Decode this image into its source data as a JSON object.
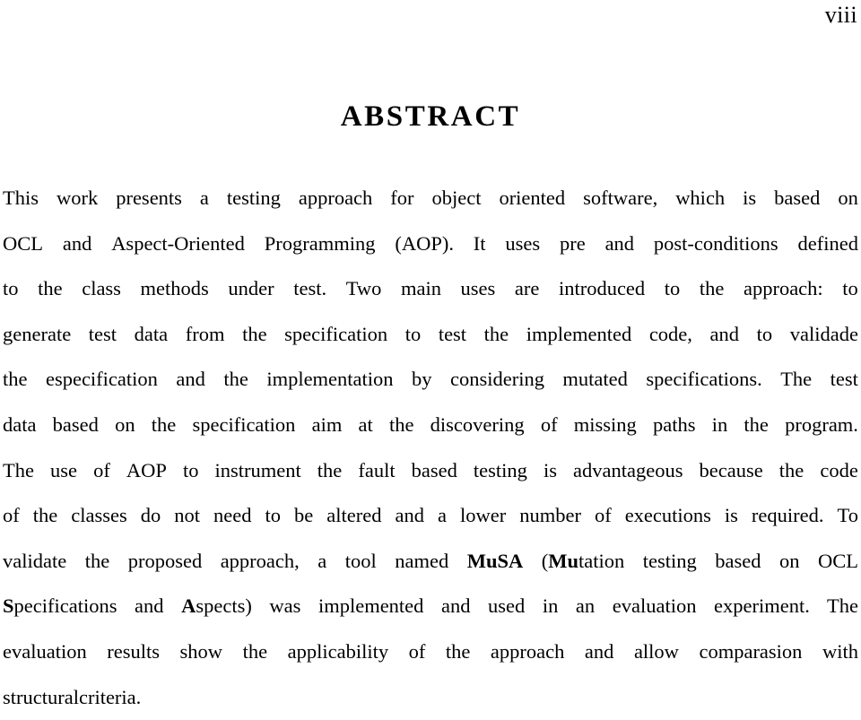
{
  "page": {
    "folio": "viii",
    "heading": "ABSTRACT"
  },
  "abstract": {
    "full_text": "This work presents a testing approach for object oriented software, which is based on OCL and Aspect-Oriented Programming (AOP). It uses pre and post-conditions defined to the class methods under test. Two main uses are introduced to the approach: to generate test data from the specification to test the implemented code, and to validade the especification and the implementation by considering mutated specifications. The test data based on the specification aim at the discovering of missing paths in the program. The use of AOP to instrument the fault based testing is advantageous because the code of the classes do not need to be altered and a lower number of executions is required. To validate the proposed approach, a tool named MuSA (Mutation testing based on OCL Specifications and Aspects) was implemented and used in an evaluation experiment. The evaluation results show the applicability of the approach and allow comparasion with structural criteria.",
    "lines": [
      {
        "id": "line-1",
        "words": [
          "This",
          "work",
          "presents",
          "a",
          "testing",
          "approach",
          "for",
          "object",
          "oriented",
          "software,",
          "which",
          "is",
          "based",
          "on"
        ]
      },
      {
        "id": "line-2",
        "words": [
          "OCL",
          "and",
          "Aspect-Oriented",
          "Programming",
          "(AOP).",
          "It",
          "uses",
          "pre",
          "and",
          "post-conditions",
          "defined"
        ]
      },
      {
        "id": "line-3",
        "words": [
          "to",
          "the",
          "class",
          "methods",
          "under",
          "test.",
          "Two",
          "main",
          "uses",
          "are",
          "introduced",
          "to",
          "the",
          "approach:",
          "to"
        ]
      },
      {
        "id": "line-4",
        "words": [
          "generate",
          "test",
          "data",
          "from",
          "the",
          "specification",
          "to",
          "test",
          "the",
          "implemented",
          "code,",
          "and",
          "to",
          "validade"
        ]
      },
      {
        "id": "line-5",
        "words": [
          "the",
          "especification",
          "and",
          "the",
          "implementation",
          "by",
          "considering",
          "mutated",
          "specifications.",
          "The",
          "test"
        ]
      },
      {
        "id": "line-6",
        "words": [
          "data",
          "based",
          "on",
          "the",
          "specification",
          "aim",
          "at",
          "the",
          "discovering",
          "of",
          "missing",
          "paths",
          "in",
          "the",
          "program."
        ]
      },
      {
        "id": "line-7",
        "words": [
          "The",
          "use",
          "of",
          "AOP",
          "to",
          "instrument",
          "the",
          "fault",
          "based",
          "testing",
          "is",
          "advantageous",
          "because",
          "the",
          "code"
        ]
      },
      {
        "id": "line-8",
        "words": [
          "of",
          "the",
          "classes",
          "do",
          "not",
          "need",
          "to",
          "be",
          "altered",
          "and",
          "a",
          "lower",
          "number",
          "of",
          "executions",
          "is",
          "required.",
          "To"
        ]
      },
      {
        "id": "line-9",
        "segments": [
          {
            "text": "validate the proposed approach, a tool named ",
            "bold": false
          },
          {
            "text": "MuSA",
            "bold": true
          },
          {
            "text": " (",
            "bold": false
          },
          {
            "text": "Mu",
            "bold": true
          },
          {
            "text": "tation testing based on OCL",
            "bold": false
          }
        ]
      },
      {
        "id": "line-10",
        "segments": [
          {
            "text": "S",
            "bold": true
          },
          {
            "text": "pecifications and ",
            "bold": false
          },
          {
            "text": "A",
            "bold": true
          },
          {
            "text": "spects) was implemented and used in an evaluation experiment. The",
            "bold": false
          }
        ]
      },
      {
        "id": "line-11",
        "words": [
          "evaluation",
          "results",
          "show",
          "the",
          "applicability",
          "of",
          "the",
          "approach",
          "and",
          "allow",
          "comparasion",
          "with"
        ]
      },
      {
        "id": "line-12",
        "last": true,
        "words": [
          "structural",
          "criteria."
        ]
      }
    ]
  },
  "style": {
    "text_color": "#000000",
    "background_color": "#ffffff"
  }
}
